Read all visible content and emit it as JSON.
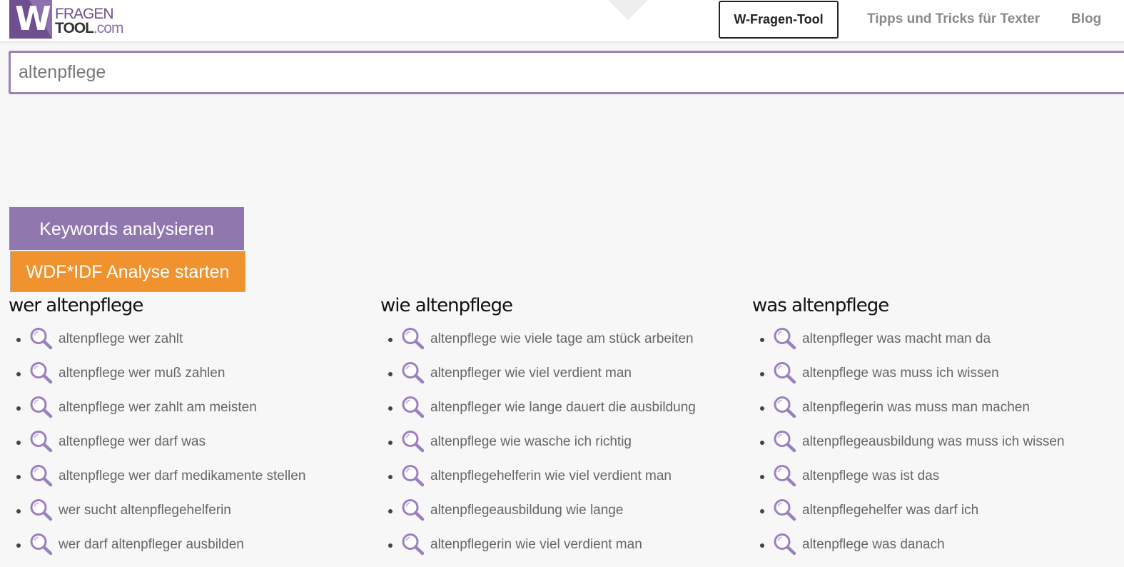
{
  "brand": {
    "mark": "W",
    "line1": "FRAGEN",
    "line2_bold": "TOOL",
    "line2_suffix": ".com"
  },
  "nav": {
    "tool": "W-Fragen-Tool",
    "tips": "Tipps und Tricks für Texter",
    "blog": "Blog"
  },
  "search": {
    "value": "altenpflege"
  },
  "buttons": {
    "keywords": "Keywords analysieren",
    "wdf": "WDF*IDF Analyse starten"
  },
  "columns": [
    {
      "title": "wer altenpflege",
      "items": [
        "altenpflege wer zahlt",
        "altenpflege wer muß zahlen",
        "altenpflege wer zahlt am meisten",
        "altenpflege wer darf was",
        "altenpflege wer darf medikamente stellen",
        "wer sucht altenpflegehelferin",
        "wer darf altenpfleger ausbilden"
      ]
    },
    {
      "title": "wie altenpflege",
      "items": [
        "altenpflege wie viele tage am stück arbeiten",
        "altenpfleger wie viel verdient man",
        "altenpfleger wie lange dauert die ausbildung",
        "altenpflege wie wasche ich richtig",
        "altenpflegehelferin wie viel verdient man",
        "altenpflegeausbildung wie lange",
        "altenpflegerin wie viel verdient man"
      ]
    },
    {
      "title": "was altenpflege",
      "items": [
        "altenpfleger was macht man da",
        "altenpflege was muss ich wissen",
        "altenpflegerin was muss man machen",
        "altenpflegeausbildung was muss ich wissen",
        "altenpflege was ist das",
        "altenpflegehelfer was darf ich",
        "altenpflege was danach"
      ]
    }
  ],
  "colors": {
    "brand_purple": "#6e4f8f",
    "button_purple": "#9078af",
    "button_orange": "#f0922e",
    "search_border": "#9b82b3",
    "icon_purple": "#9b7fc0"
  },
  "icons": {
    "result": "magnifier-icon"
  }
}
